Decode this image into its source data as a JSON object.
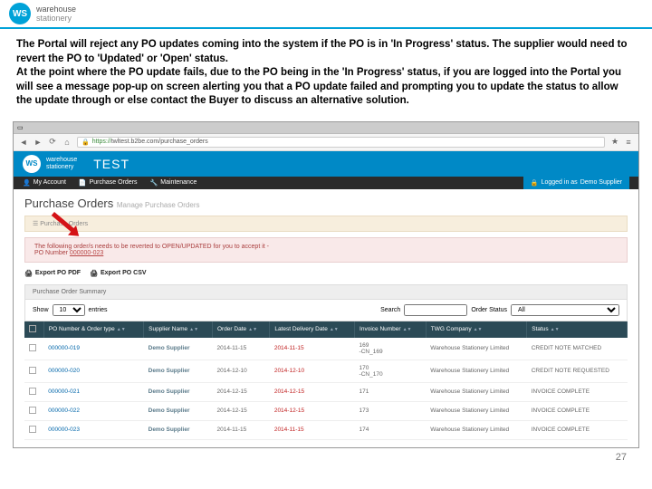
{
  "header": {
    "logo_text": "WS",
    "brand_line1": "warehouse",
    "brand_line2": "stationery"
  },
  "doc": {
    "paragraph": "The Portal will reject any PO updates coming into the system if the PO is in 'In Progress' status. The supplier would need to revert the PO to 'Updated' or 'Open' status.\nAt the point where the PO update fails, due to the PO being in the 'In Progress' status, if you are logged into the Portal you will see a message pop-up on screen alerting you that a PO update failed and prompting you to update the status to allow the update through or else contact the Buyer to discuss an alternative solution."
  },
  "browser": {
    "url_prefix": "https://",
    "url_rest": "twltest.b2be.com/purchase_orders"
  },
  "banner": {
    "logo": "WS",
    "brand1": "warehouse",
    "brand2": "stationery",
    "label": "TEST"
  },
  "menu": {
    "account": "My Account",
    "po": "Purchase Orders",
    "maint": "Maintenance",
    "login_prefix": "Logged in as",
    "login_user": "Demo Supplier"
  },
  "page": {
    "title": "Purchase Orders",
    "subtitle": "Manage Purchase Orders",
    "breadcrumb": "Purchase Orders"
  },
  "warning": {
    "text": "The following order/s needs to be reverted to OPEN/UPDATED for you to accept it -",
    "po_label": "PO Number",
    "po_value": "000000-023"
  },
  "export": {
    "pdf": "Export PO PDF",
    "csv": "Export PO CSV"
  },
  "summary": {
    "title": "Purchase Order Summary",
    "show": "Show",
    "show_val": "10",
    "entries": "entries",
    "search": "Search",
    "status_label": "Order Status",
    "status_val": "All"
  },
  "columns": {
    "c0": "",
    "c1": "PO Number & Order type",
    "c2": "Supplier Name",
    "c3": "Order Date",
    "c4": "Latest Delivery Date",
    "c5": "Invoice Number",
    "c6": "TWG Company",
    "c7": "Status"
  },
  "rows": [
    {
      "po": "000000-019",
      "supplier": "Demo Supplier",
      "odate": "2014-11-15",
      "ddate": "2014-11-15",
      "inv": "169",
      "sub": "-CN_169",
      "company": "Warehouse Stationery Limited",
      "status": "CREDIT NOTE MATCHED"
    },
    {
      "po": "000000-020",
      "supplier": "Demo Supplier",
      "odate": "2014-12-10",
      "ddate": "2014-12-10",
      "inv": "170",
      "sub": "-CN_170",
      "company": "Warehouse Stationery Limited",
      "status": "CREDIT NOTE REQUESTED"
    },
    {
      "po": "000000-021",
      "supplier": "Demo Supplier",
      "odate": "2014-12-15",
      "ddate": "2014-12-15",
      "inv": "171",
      "sub": "",
      "company": "Warehouse Stationery Limited",
      "status": "INVOICE COMPLETE"
    },
    {
      "po": "000000-022",
      "supplier": "Demo Supplier",
      "odate": "2014-12-15",
      "ddate": "2014-12-15",
      "inv": "173",
      "sub": "",
      "company": "Warehouse Stationery Limited",
      "status": "INVOICE COMPLETE"
    },
    {
      "po": "000000-023",
      "supplier": "Demo Supplier",
      "odate": "2014-11-15",
      "ddate": "2014-11-15",
      "inv": "174",
      "sub": "",
      "company": "Warehouse Stationery Limited",
      "status": "INVOICE COMPLETE"
    }
  ],
  "page_number": "27"
}
